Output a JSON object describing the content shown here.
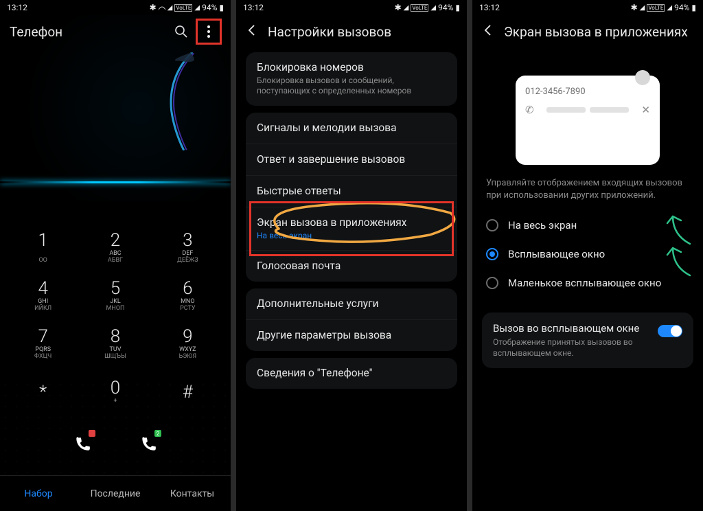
{
  "status": {
    "time": "13:12",
    "battery": "94%"
  },
  "p1": {
    "title": "Телефон",
    "keys": [
      {
        "d": "1",
        "s1": "",
        "s2": "ОО"
      },
      {
        "d": "2",
        "s1": "ABC",
        "s2": "АБВГ"
      },
      {
        "d": "3",
        "s1": "DEF",
        "s2": "ДЕЁЖЗ"
      },
      {
        "d": "4",
        "s1": "GHI",
        "s2": "ИЙКЛ"
      },
      {
        "d": "5",
        "s1": "JKL",
        "s2": "МНОП"
      },
      {
        "d": "6",
        "s1": "MNO",
        "s2": "РСТУ"
      },
      {
        "d": "7",
        "s1": "PQRS",
        "s2": "ФХЦЧ"
      },
      {
        "d": "8",
        "s1": "TUV",
        "s2": "ШЩЪЫ"
      },
      {
        "d": "9",
        "s1": "WXYZ",
        "s2": "ЬЭЮЯ"
      },
      {
        "d": "*",
        "s1": "",
        "s2": ""
      },
      {
        "d": "0",
        "s1": "+",
        "s2": ""
      },
      {
        "d": "#",
        "s1": "",
        "s2": ""
      }
    ],
    "tabs": [
      "Набор",
      "Последние",
      "Контакты"
    ]
  },
  "p2": {
    "title": "Настройки вызовов",
    "items": [
      {
        "t": "Блокировка номеров",
        "s": "Блокировка вызовов и сообщений, поступающих с определенных номеров"
      },
      {
        "t": "Сигналы и мелодии вызова"
      },
      {
        "t": "Ответ и завершение вызовов"
      },
      {
        "t": "Быстрые ответы"
      },
      {
        "t": "Экран вызова в приложениях",
        "b": "На весь экран"
      },
      {
        "t": "Голосовая почта"
      },
      {
        "t": "Дополнительные услуги"
      },
      {
        "t": "Другие параметры вызова"
      },
      {
        "t": "Сведения о \"Телефоне\""
      }
    ]
  },
  "p3": {
    "title": "Экран вызова в приложениях",
    "preview_number": "012-3456-7890",
    "desc": "Управляйте отображением входящих вызовов при использовании других приложений.",
    "radios": [
      "На весь экран",
      "Всплывающее окно",
      "Маленькое всплывающее окно"
    ],
    "toggle": {
      "t": "Вызов во всплывающем окне",
      "s": "Отображение принятых вызовов во всплывающем окне."
    }
  }
}
